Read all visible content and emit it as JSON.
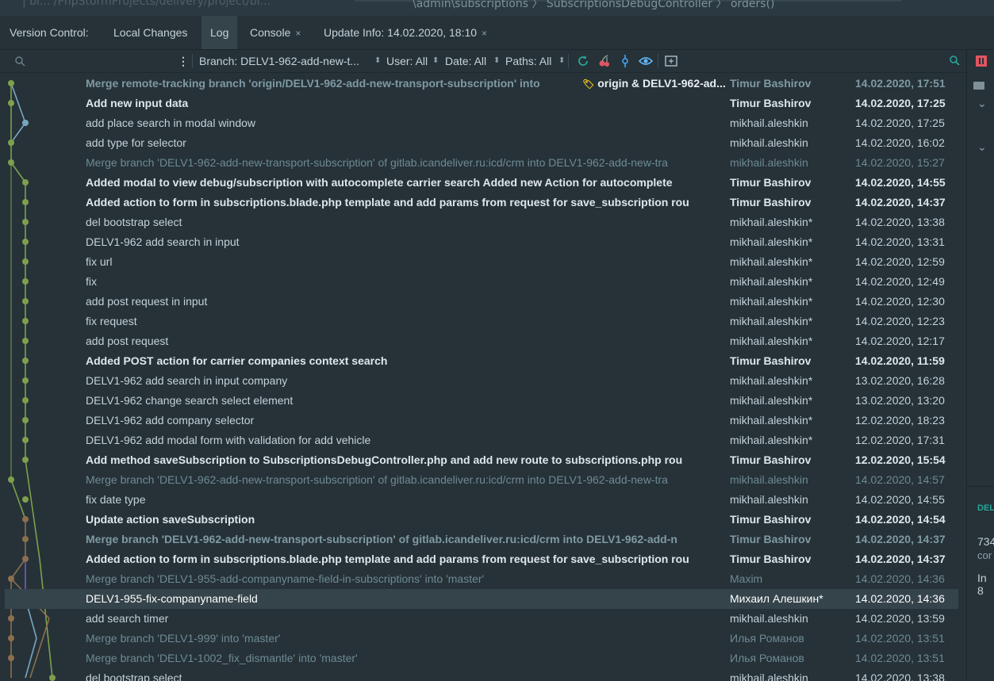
{
  "topstrip": {
    "path_left": "| bl... /PhpStormProjects/delivery/project/bi...",
    "path_right": "\\admin\\subscriptions  〉 SubscriptionsDebugController  〉 orders()"
  },
  "tabs": {
    "prefix": "Version Control:",
    "items": [
      {
        "label": "Local Changes",
        "closable": false
      },
      {
        "label": "Log",
        "closable": false,
        "active": true
      },
      {
        "label": "Console",
        "closable": true
      },
      {
        "label": "Update Info: 14.02.2020, 18:10",
        "closable": true
      }
    ],
    "close_glyph": "×"
  },
  "toolbar": {
    "search_placeholder": "",
    "branch": "Branch: DELV1-962-add-new-t...",
    "user": "User: All",
    "date": "Date: All",
    "paths": "Paths: All",
    "icons": [
      "refresh-icon",
      "cherry-pick-icon",
      "commit-icon",
      "eye-icon",
      "diff-icon"
    ]
  },
  "colors": {
    "background": "#263238",
    "selected_row": "#35444b",
    "accent": "#009688",
    "graph_green": "#7ea04d",
    "graph_blue": "#78a6c0",
    "graph_brown": "#8c6f4e",
    "graph_purple": "#7e57c2"
  },
  "tag": {
    "label": "origin & DELV1-962-ad..."
  },
  "rightpanel": {
    "title": "DEL",
    "line1": "734",
    "line2": "cor",
    "line3": "In 8"
  },
  "commits": [
    {
      "message": "Merge remote-tracking branch 'origin/DELV1-962-add-new-transport-subscription' into",
      "author": "Timur Bashirov",
      "date": "14.02.2020, 17:51",
      "style": "mergebold",
      "has_tag": true
    },
    {
      "message": "Add new input data",
      "author": "Timur Bashirov",
      "date": "14.02.2020, 17:25",
      "style": "bold"
    },
    {
      "message": "add place search in modal window",
      "author": "mikhail.aleshkin",
      "date": "14.02.2020, 17:25",
      "style": "normal"
    },
    {
      "message": "add type for selector",
      "author": "mikhail.aleshkin",
      "date": "14.02.2020, 16:02",
      "style": "normal"
    },
    {
      "message": "Merge branch 'DELV1-962-add-new-transport-subscription' of gitlab.icandeliver.ru:icd/crm into DELV1-962-add-new-tra",
      "author": "mikhail.aleshkin",
      "date": "14.02.2020, 15:27",
      "style": "merge"
    },
    {
      "message": "Added modal to view debug/subscription with autocomplete carrier search Added new Action for autocomplete",
      "author": "Timur Bashirov",
      "date": "14.02.2020, 14:55",
      "style": "bold"
    },
    {
      "message": "Added action to form in subscriptions.blade.php template and add params from request for save_subscription rou",
      "author": "Timur Bashirov",
      "date": "14.02.2020, 14:37",
      "style": "bold"
    },
    {
      "message": "del bootstrap select",
      "author": "mikhail.aleshkin*",
      "date": "14.02.2020, 13:38",
      "style": "normal"
    },
    {
      "message": "DELV1-962 add search in input",
      "author": "mikhail.aleshkin*",
      "date": "14.02.2020, 13:31",
      "style": "normal"
    },
    {
      "message": "fix url",
      "author": "mikhail.aleshkin*",
      "date": "14.02.2020, 12:59",
      "style": "normal"
    },
    {
      "message": "fix",
      "author": "mikhail.aleshkin*",
      "date": "14.02.2020, 12:49",
      "style": "normal"
    },
    {
      "message": "add post request in input",
      "author": "mikhail.aleshkin*",
      "date": "14.02.2020, 12:30",
      "style": "normal"
    },
    {
      "message": "fix request",
      "author": "mikhail.aleshkin*",
      "date": "14.02.2020, 12:23",
      "style": "normal"
    },
    {
      "message": "add post request",
      "author": "mikhail.aleshkin*",
      "date": "14.02.2020, 12:17",
      "style": "normal"
    },
    {
      "message": "Added POST action for carrier companies context search",
      "author": "Timur Bashirov",
      "date": "14.02.2020, 11:59",
      "style": "bold"
    },
    {
      "message": "DELV1-962 add search in input company",
      "author": "mikhail.aleshkin*",
      "date": "13.02.2020, 16:28",
      "style": "normal"
    },
    {
      "message": "DELV1-962 change search select element",
      "author": "mikhail.aleshkin*",
      "date": "13.02.2020, 13:20",
      "style": "normal"
    },
    {
      "message": "DELV1-962 add company selector",
      "author": "mikhail.aleshkin*",
      "date": "12.02.2020, 18:23",
      "style": "normal"
    },
    {
      "message": "DELV1-962 add modal form with validation for add vehicle",
      "author": "mikhail.aleshkin*",
      "date": "12.02.2020, 17:31",
      "style": "normal"
    },
    {
      "message": "Add method saveSubscription to SubscriptionsDebugController.php and add new route to  subscriptions.php rou",
      "author": "Timur Bashirov",
      "date": "12.02.2020, 15:54",
      "style": "bold"
    },
    {
      "message": "Merge branch 'DELV1-962-add-new-transport-subscription' of gitlab.icandeliver.ru:icd/crm into DELV1-962-add-new-tra",
      "author": "mikhail.aleshkin",
      "date": "14.02.2020, 14:57",
      "style": "merge"
    },
    {
      "message": "fix date type",
      "author": "mikhail.aleshkin",
      "date": "14.02.2020, 14:55",
      "style": "normal"
    },
    {
      "message": "Update action saveSubscription",
      "author": "Timur Bashirov",
      "date": "14.02.2020, 14:54",
      "style": "bold"
    },
    {
      "message": "Merge branch 'DELV1-962-add-new-transport-subscription' of gitlab.icandeliver.ru:icd/crm into DELV1-962-add-n",
      "author": "Timur Bashirov",
      "date": "14.02.2020, 14:37",
      "style": "mergebold"
    },
    {
      "message": "Added action to form in subscriptions.blade.php template and add params from request for save_subscription rou",
      "author": "Timur Bashirov",
      "date": "14.02.2020, 14:37",
      "style": "bold"
    },
    {
      "message": "Merge branch 'DELV1-955-add-companyname-field-in-subscriptions' into 'master'",
      "author": "Maxim",
      "date": "14.02.2020, 14:36",
      "style": "merge"
    },
    {
      "message": "DELV1-955-fix-companyname-field",
      "author": "Михаил Алешкин*",
      "date": "14.02.2020, 14:36",
      "style": "normal",
      "selected": true
    },
    {
      "message": "add search timer",
      "author": "mikhail.aleshkin",
      "date": "14.02.2020, 13:59",
      "style": "normal"
    },
    {
      "message": "Merge branch 'DELV1-999' into 'master'",
      "author": "Илья Романов",
      "date": "14.02.2020, 13:51",
      "style": "merge"
    },
    {
      "message": "Merge branch 'DELV1-1002_fix_dismantle' into 'master'",
      "author": "Илья Романов",
      "date": "14.02.2020, 13:51",
      "style": "merge"
    },
    {
      "message": "del bootstrap select",
      "author": "mikhail.aleshkin",
      "date": "14.02.2020, 13:38",
      "style": "normal"
    }
  ]
}
